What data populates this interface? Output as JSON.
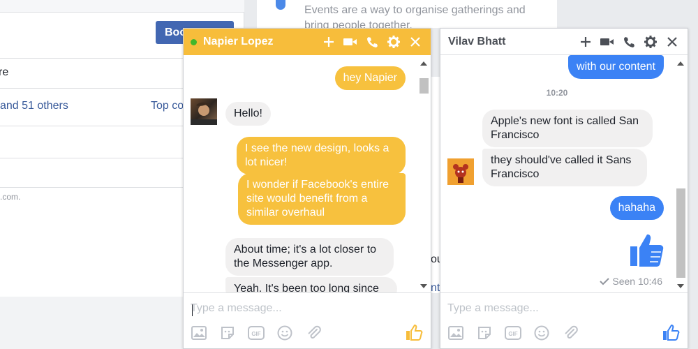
{
  "background": {
    "book_button_label": "Boo",
    "row1_text": "re",
    "row2_link": "and 51 others",
    "row2_right": "Top co",
    "row3_small": ".com.",
    "events_text": "Events are a way to organise gatherings and bring people together.",
    "frag_ou": "ou",
    "frag_nt": "nt"
  },
  "chat_napier": {
    "title": "Napier Lopez",
    "accent_color": "#f7bd3b",
    "online": true,
    "header_icons": [
      "plus-icon",
      "video-icon",
      "phone-icon",
      "gear-icon",
      "close-icon"
    ],
    "messages": [
      {
        "dir": "out",
        "text": "hey Napier"
      },
      {
        "dir": "in",
        "text": "Hello!"
      },
      {
        "dir": "out",
        "text": "I see the new design, looks a lot nicer!"
      },
      {
        "dir": "out",
        "text": "I wonder if Facebook's entire site would benefit from a similar overhaul"
      },
      {
        "dir": "in",
        "text": "About time; it's a lot closer to the Messenger app."
      },
      {
        "dir": "in",
        "text": "Yeah. It's been too long since"
      }
    ],
    "input_placeholder": "Type a message...",
    "toolbar_icons": [
      "image-icon",
      "sticker-icon",
      "gif-icon",
      "emoji-icon",
      "attachment-icon"
    ],
    "like_icon": "thumbs-up-icon",
    "gif_label": "GIF"
  },
  "chat_vilav": {
    "title": "Vilav Bhatt",
    "accent_color": "#3b82f5",
    "header_icons": [
      "plus-icon",
      "video-icon",
      "phone-icon",
      "gear-icon",
      "close-icon"
    ],
    "messages": [
      {
        "dir": "out",
        "text": "with our content"
      },
      {
        "dir": "in",
        "text": "Apple's new font is called San Francisco"
      },
      {
        "dir": "in",
        "text": "they should've called it Sans Francisco"
      },
      {
        "dir": "out",
        "text": "hahaha"
      }
    ],
    "time_divider": "10:20",
    "seen_text": "Seen 10:46",
    "input_placeholder": "Type a message...",
    "toolbar_icons": [
      "image-icon",
      "sticker-icon",
      "gif-icon",
      "emoji-icon",
      "attachment-icon"
    ],
    "like_icon": "thumbs-up-icon",
    "gif_label": "GIF"
  }
}
